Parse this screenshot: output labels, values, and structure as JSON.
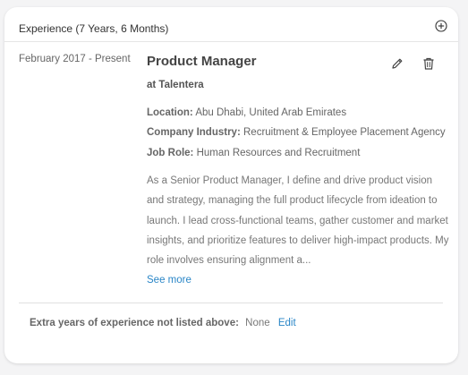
{
  "section": {
    "title": "Experience (7 Years, 6 Months)",
    "add_icon": "plus-circle-icon"
  },
  "experience": {
    "date_range": "February 2017 - Present",
    "job_title": "Product Manager",
    "company": "at Talentera",
    "edit_icon": "pencil-icon",
    "delete_icon": "trash-icon",
    "location_label": "Location:",
    "location_value": "Abu Dhabi, United Arab Emirates",
    "industry_label": "Company Industry:",
    "industry_value": "Recruitment & Employee Placement Agency",
    "role_label": "Job Role:",
    "role_value": "Human Resources and Recruitment",
    "description": "As a Senior Product Manager, I define and drive product vision and strategy, managing the full product lifecycle from ideation to launch. I lead cross-functional teams, gather customer and market insights, and prioritize features to deliver high-impact products. My role involves ensuring alignment a...",
    "see_more": "See more"
  },
  "extra": {
    "label": "Extra years of experience not listed above:",
    "value": "None",
    "edit": "Edit"
  },
  "colors": {
    "link": "#2a86c7",
    "background": "#f4f4f5",
    "card": "#ffffff"
  }
}
